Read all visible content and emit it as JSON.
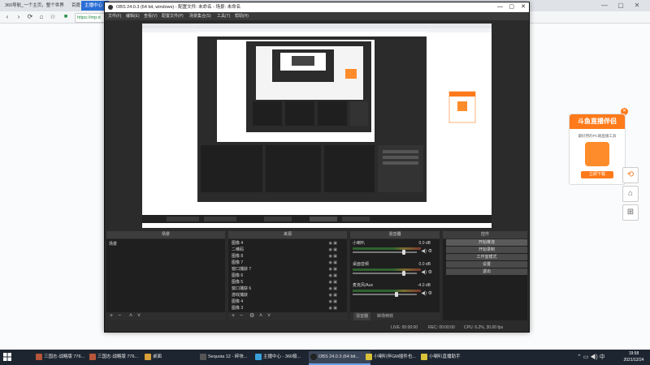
{
  "browser": {
    "tabs": [
      {
        "label": "360导航_一个主页，整个世界"
      },
      {
        "label": "百度一下，你就知道"
      },
      {
        "label": "主播中心"
      }
    ],
    "address": "https://mp.d",
    "controls": {
      "back": "‹",
      "forward": "›",
      "refresh": "⟳",
      "home": "⌂",
      "star": "☆"
    },
    "window_controls": {
      "min": "—",
      "max": "▢",
      "close": "✕"
    }
  },
  "obs": {
    "title": "OBS 24.0.3 (64 bit, windows) - 配置文件: 未命名 - 场景: 未命名",
    "menu": [
      "文件(F)",
      "编辑(E)",
      "查看(V)",
      "配置文件(P)",
      "场景集合(S)",
      "工具(T)",
      "帮助(H)"
    ],
    "docks": {
      "scenes": "场景",
      "sources": "来源",
      "mixer": "混音器",
      "controls": "控件"
    },
    "scene_list": [
      "场景"
    ],
    "sources": [
      "图像 4",
      "二维码",
      "图像 8",
      "图像 7",
      "窗口捕获 7",
      "图像 6",
      "图像 5",
      "窗口捕获 6",
      "游戏捕获",
      "图像 4",
      "图像 3"
    ],
    "mixer": [
      {
        "name": "小喇叭",
        "db": "0.0 dB",
        "level": 0.55
      },
      {
        "name": "桌面音频",
        "db": "0.0 dB",
        "level": 0.65
      },
      {
        "name": "麦克风/Aux",
        "db": "-4.0 dB",
        "level": 0.45
      }
    ],
    "mixer_tabs": [
      "混音器",
      "转场特效"
    ],
    "controls": [
      "开始推流",
      "开始录制",
      "工作室模式",
      "设置",
      "退出"
    ],
    "status": {
      "live": "LIVE: 00:00:00",
      "rec": "REC: 00:00:00",
      "cpu": "CPU: 6.2%, 30.00 fps"
    }
  },
  "ad": {
    "title": "斗鱼直播伴侣",
    "subtitle": "最好用的PC端直播工具",
    "button": "立即下载",
    "close": "✕"
  },
  "side_buttons": [
    "⟲",
    "⌂",
    "⊞"
  ],
  "taskbar": {
    "items": [
      {
        "label": "三国志·战略版 776..."
      },
      {
        "label": "三国志·战略版 776..."
      },
      {
        "label": "桌面"
      },
      {
        "label": "Sequoia 12 - 碎块..."
      },
      {
        "label": "主播中心 - 360极..."
      },
      {
        "label": "OBS 24.0.3 (64 bit..."
      },
      {
        "label": "小喇叭伴GM插件也..."
      },
      {
        "label": "小喇叭直播助手"
      }
    ],
    "time": "19:58",
    "date": "2021/12/24"
  },
  "colors": {
    "accent": "#2b6fd6",
    "obs_bg": "#2b2b2b",
    "ad_orange": "#ff7a1a"
  }
}
